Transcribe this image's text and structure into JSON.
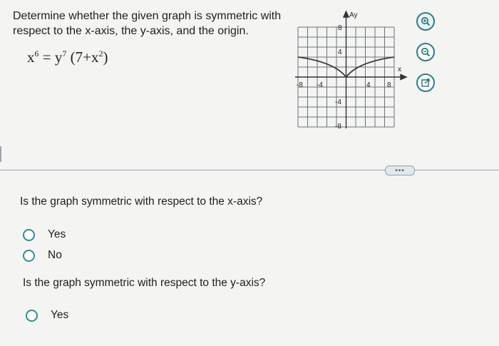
{
  "prompt_text": "Determine whether the given graph is symmetric with respect to the x-axis, the y-axis, and the origin.",
  "equation": {
    "lhs_base": "x",
    "lhs_exp": "6",
    "equals": "=",
    "rhs_base": "y",
    "rhs_exp": "7",
    "paren_open": "(",
    "inner_const": "7",
    "plus": "+",
    "inner_base": "x",
    "inner_exp": "2",
    "paren_close": ")"
  },
  "graph": {
    "y_axis_label": "Ay",
    "x_axis_label": "x",
    "x_tick_labels": [
      "-8",
      "-4",
      "4",
      "8"
    ],
    "y_tick_labels": [
      "8",
      "4",
      "-4",
      "-8"
    ]
  },
  "tools": {
    "zoom_in": "zoom-in-icon",
    "zoom_out": "zoom-out-icon",
    "open_new": "external-link-icon"
  },
  "more_button": "•••",
  "questions": [
    {
      "text": "Is the graph symmetric with respect to the x-axis?",
      "options": [
        "Yes",
        "No"
      ]
    },
    {
      "text": "Is the graph symmetric with respect to the y-axis?",
      "options": [
        "Yes"
      ]
    }
  ]
}
